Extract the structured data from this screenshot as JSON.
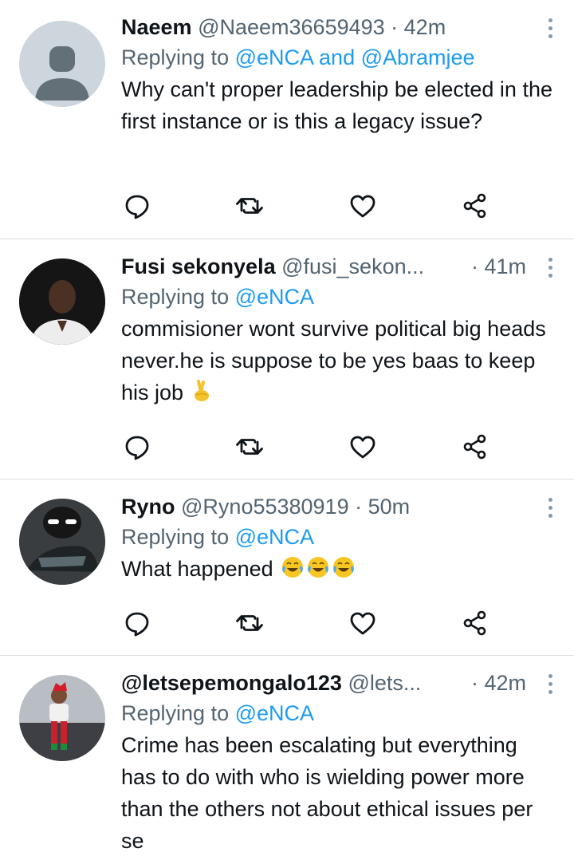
{
  "tweets": [
    {
      "name": "Naeem",
      "handle": "@Naeem36659493",
      "time": "· 42m",
      "replying_prefix": "Replying to ",
      "replying_to": "@eNCA and @Abramjee",
      "text": "Why can't proper leadership be elected in the first instance or is this a legacy issue?",
      "avatar": "default-avatar"
    },
    {
      "name": "Fusi sekonyela",
      "handle": "@fusi_sekon...",
      "time": "· 41m",
      "replying_prefix": "Replying to ",
      "replying_to": "@eNCA",
      "text": "commisioner wont survive political big heads never.he is suppose to be yes baas to keep his job",
      "emoji": "fingers-crossed-emoji",
      "avatar": "user-photo"
    },
    {
      "name": "Ryno",
      "handle": "@Ryno55380919",
      "time": "· 50m",
      "replying_prefix": "Replying to ",
      "replying_to": "@eNCA",
      "text": "What happened",
      "emoji": "tears-of-joy-emoji x3",
      "avatar": "user-photo"
    },
    {
      "name": "@letsepemongalo123",
      "handle": "@lets...",
      "time": "· 42m",
      "replying_prefix": "Replying to ",
      "replying_to": "@eNCA",
      "text": "Crime has been escalating but everything has to do with who is wielding power more than the others not about ethical issues per se",
      "avatar": "user-photo"
    }
  ],
  "icons": {
    "reply": "reply-icon",
    "retweet": "retweet-icon",
    "like": "heart-icon",
    "share": "share-icon",
    "more": "more-icon"
  },
  "colors": {
    "link": "#1d9bf0",
    "muted": "#536471",
    "text": "#0f1419",
    "divider": "#dbe0e4"
  }
}
